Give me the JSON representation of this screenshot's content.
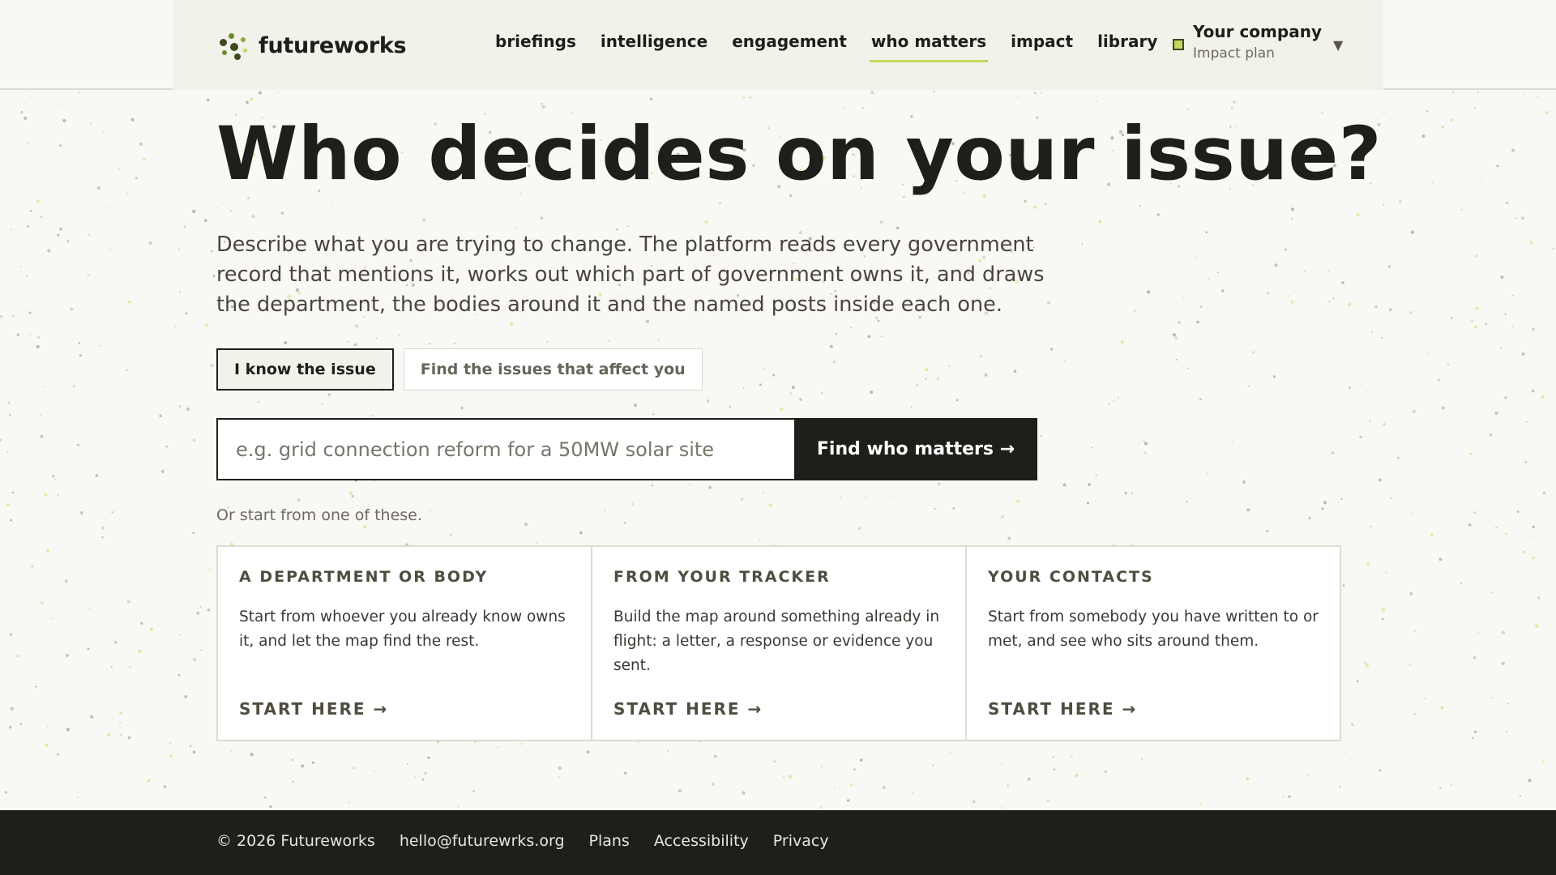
{
  "brand": {
    "name": "futureworks"
  },
  "nav": {
    "items": [
      {
        "label": "briefings"
      },
      {
        "label": "intelligence"
      },
      {
        "label": "engagement"
      },
      {
        "label": "who matters",
        "active": true
      },
      {
        "label": "impact"
      },
      {
        "label": "library"
      }
    ]
  },
  "account": {
    "name": "Your company",
    "plan": "Impact plan"
  },
  "hero": {
    "title": "Who decides on your issue?",
    "lede": "Describe what you are trying to change. The platform reads every government record that mentions it, works out which part of government owns it, and draws the department, the bodies around it and the named posts inside each one."
  },
  "mode_toggle": {
    "known": "I know the issue",
    "discover": "Find the issues that affect you"
  },
  "search": {
    "placeholder": "e.g. grid connection reform for a 50MW solar site",
    "value": "",
    "button": "Find who matters →"
  },
  "starts": {
    "intro": "Or start from one of these.",
    "cards": [
      {
        "title": "A department or body",
        "body": "Start from whoever you already know owns it, and let the map find the rest.",
        "cta": "Start here →"
      },
      {
        "title": "From your tracker",
        "body": "Build the map around something already in flight: a letter, a response or evidence you sent.",
        "cta": "Start here →"
      },
      {
        "title": "Your contacts",
        "body": "Start from somebody you have written to or met, and see who sits around them.",
        "cta": "Start here →"
      }
    ]
  },
  "footer": {
    "copyright": "© 2026 Futureworks",
    "email": "hello@futurewrks.org",
    "links": [
      "Plans",
      "Accessibility",
      "Privacy"
    ]
  },
  "colors": {
    "ink": "#1f1e1a",
    "accent": "#c4d65d",
    "panel": "#f2f2ea",
    "background": "#f9f8f4"
  }
}
